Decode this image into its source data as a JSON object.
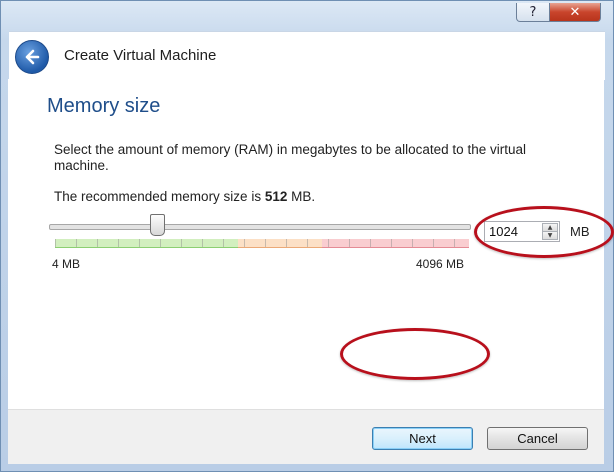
{
  "window": {
    "title_controls": {
      "help": "?",
      "close": "✕"
    }
  },
  "header": {
    "title": "Create Virtual Machine",
    "back_icon": "back-arrow-icon"
  },
  "page": {
    "heading": "Memory size",
    "description": "Select the amount of memory (RAM) in megabytes to be allocated to the virtual machine.",
    "recommend_prefix": "The recommended memory size is ",
    "recommend_value": "512",
    "recommend_suffix": " MB."
  },
  "memory": {
    "slider_min_label": "4 MB",
    "slider_max_label": "4096 MB",
    "min": 4,
    "max": 4096,
    "value": 1024,
    "value_text": "1024",
    "unit": "MB"
  },
  "buttons": {
    "next": "Next",
    "cancel": "Cancel"
  },
  "colors": {
    "heading": "#1f4e8a",
    "highlight": "#b8101c"
  }
}
